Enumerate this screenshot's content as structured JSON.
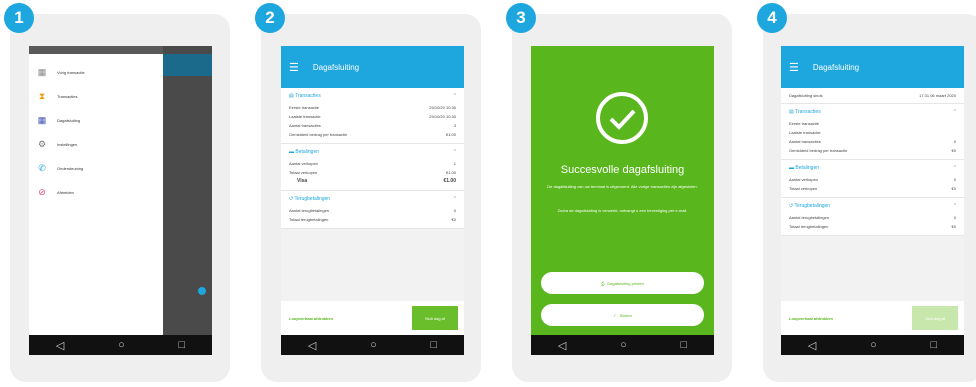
{
  "steps": [
    "1",
    "2",
    "3",
    "4"
  ],
  "navbar": {
    "back": "◁",
    "home": "○",
    "recent": "□"
  },
  "screen1": {
    "drawer_items": [
      {
        "label": "Vorig transactie",
        "icon": "receipt-icon",
        "color": "#888888"
      },
      {
        "label": "Transacties",
        "icon": "hourglass-icon",
        "color": "#f39c12"
      },
      {
        "label": "Dagafsluiting",
        "icon": "calendar-icon",
        "color": "#3f51b5"
      },
      {
        "label": "Instellingen",
        "icon": "gear-icon",
        "color": "#777777"
      },
      {
        "label": "Ondersteuning",
        "icon": "support-icon",
        "color": "#1ea6df"
      },
      {
        "label": "Afmelden",
        "icon": "logout-icon",
        "color": "#e5477a"
      }
    ]
  },
  "screen2": {
    "title": "Dagafsluiting",
    "transactions": {
      "header": "Transacties",
      "rows": [
        {
          "label": "Eerste transactie",
          "value": "29/10/20 10:30"
        },
        {
          "label": "Laatste transactie",
          "value": "29/10/20 10:30"
        },
        {
          "label": "Aantal transacties",
          "value": "3"
        },
        {
          "label": "Gemiddeld bedrag per transactie",
          "value": "€1.00"
        }
      ]
    },
    "payments": {
      "header": "Betalingen",
      "rows": [
        {
          "label": "Aantal verkopen",
          "value": "1"
        },
        {
          "label": "Totaal verkopen",
          "value": "€1.00"
        }
      ],
      "visa_label": "Visa",
      "visa_value": "€1.00"
    },
    "refunds": {
      "header": "Terugbetalingen",
      "rows": [
        {
          "label": "Aantal terugbetalingen",
          "value": "0"
        },
        {
          "label": "Totaal terugbetalingen",
          "value": "€0"
        }
      ]
    },
    "footer_link": "Loopverhaal afdrukken",
    "footer_button": "Sluit dag af"
  },
  "screen3": {
    "title": "Succesvolle dagafsluiting",
    "message1": "De dagafsluiting van uw terminal is uitgevoerd. Alle vorige transacties zijn afgesloten.",
    "message2": "Zodra de dagafsluiting is verwerkt, ontvangt u een bevestiging per e-mail.",
    "button1": "Dagafsluiting printen",
    "button2": "Sluiten"
  },
  "screen4": {
    "title": "Dagafsluiting",
    "top_row": {
      "label": "Dagafsluiting sinds",
      "value": "17:31 06 maart 2020"
    },
    "transactions": {
      "header": "Transacties",
      "rows": [
        {
          "label": "Eerste transactie",
          "value": ""
        },
        {
          "label": "Laatste transactie",
          "value": ""
        },
        {
          "label": "Aantal transacties",
          "value": "0"
        },
        {
          "label": "Gemiddeld bedrag per transactie",
          "value": "€0"
        }
      ]
    },
    "payments": {
      "header": "Betalingen",
      "rows": [
        {
          "label": "Aantal verkopen",
          "value": "0"
        },
        {
          "label": "Totaal verkopen",
          "value": "€0"
        }
      ]
    },
    "refunds": {
      "header": "Terugbetalingen",
      "rows": [
        {
          "label": "Aantal terugbetalingen",
          "value": "0"
        },
        {
          "label": "Totaal terugbetalingen",
          "value": "€0"
        }
      ]
    },
    "footer_link": "Loopverhaal afdrukken",
    "footer_button": "Sluit dag af"
  },
  "colors": {
    "accent": "#1ea6df",
    "success": "#59b71d",
    "panel": "#efefef"
  }
}
